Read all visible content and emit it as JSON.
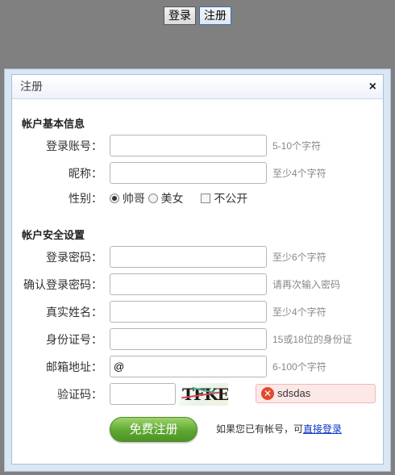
{
  "top_buttons": {
    "login": "登录",
    "register": "注册"
  },
  "dialog": {
    "title": "注册",
    "close_glyph": "×",
    "account_section": {
      "title": "帐户基本信息",
      "username": {
        "label": "登录账号：",
        "value": "",
        "hint": "5-10个字符"
      },
      "nickname": {
        "label": "昵称：",
        "value": "",
        "hint": "至少4个字符"
      },
      "gender": {
        "label": "性别：",
        "options": [
          "帅哥",
          "美女"
        ],
        "selected": "帅哥",
        "private_label": "不公开"
      }
    },
    "security_section": {
      "title": "帐户安全设置",
      "password": {
        "label": "登录密码：",
        "value": "",
        "hint": "至少6个字符"
      },
      "confirm_password": {
        "label": "确认登录密码：",
        "value": "",
        "hint": "请再次输入密码"
      },
      "real_name": {
        "label": "真实姓名：",
        "value": "",
        "hint": "至少4个字符"
      },
      "id_number": {
        "label": "身份证号：",
        "value": "",
        "hint": "15或18位的身份证"
      },
      "email": {
        "label": "邮箱地址：",
        "value": "@",
        "hint": "6-100个字符"
      },
      "captcha": {
        "label": "验证码：",
        "value": "",
        "image_text": "TFKE",
        "error": "sdsdas"
      }
    },
    "submit_label": "免费注册",
    "login_tip": "如果您已有帐号，可",
    "login_link": "直接登录"
  }
}
